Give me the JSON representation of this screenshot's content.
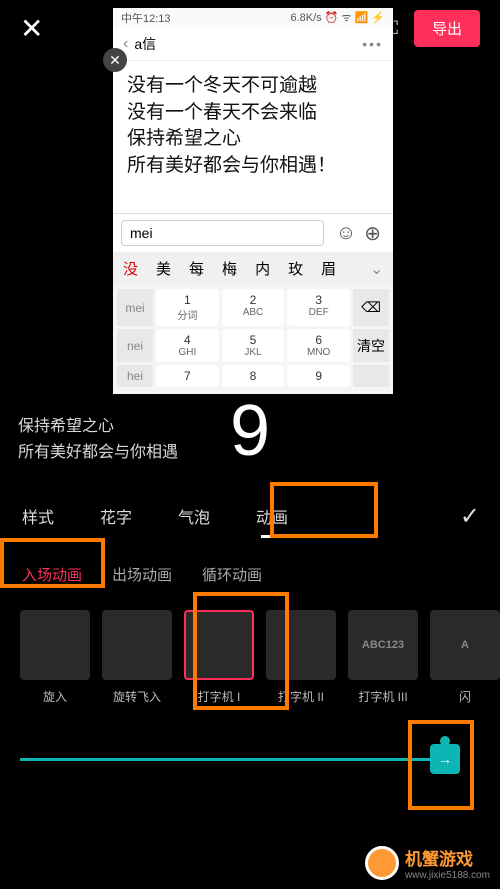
{
  "topbar": {
    "export_label": "导出"
  },
  "phone": {
    "status_time": "中午12:13",
    "status_right": "6.8K/s ⏰ ᯤ 📶 ⚡",
    "chat_title": "a信",
    "text_line1": "没有一个冬天不可逾越",
    "text_line2": "没有一个春天不会来临",
    "text_line3": "保持希望之心",
    "text_line4": "所有美好都会与你相遇！",
    "input_value": "mei",
    "suggestions": [
      "没",
      "美",
      "每",
      "梅",
      "内",
      "玫",
      "眉"
    ],
    "keyb_side": [
      "mei",
      "nei",
      "hei"
    ],
    "keyb_keys": [
      {
        "num": "1",
        "abc": "分词"
      },
      {
        "num": "2",
        "abc": "ABC"
      },
      {
        "num": "3",
        "abc": "DEF"
      },
      {
        "num": "4",
        "abc": "GHI"
      },
      {
        "num": "5",
        "abc": "JKL"
      },
      {
        "num": "6",
        "abc": "MNO"
      },
      {
        "num": "7",
        "abc": ""
      },
      {
        "num": "8",
        "abc": ""
      },
      {
        "num": "9",
        "abc": ""
      }
    ],
    "keyb_extra": [
      "⌫",
      "清空"
    ]
  },
  "big_number": "9",
  "preview_line1": "保持希望之心",
  "preview_line2": "所有美好都会与你相遇",
  "tabs": {
    "style": "样式",
    "flower": "花字",
    "bubble": "气泡",
    "animation": "动画"
  },
  "subtabs": {
    "enter": "入场动画",
    "exit": "出场动画",
    "loop": "循环动画"
  },
  "animations": [
    {
      "label": "旋入",
      "thumb": ""
    },
    {
      "label": "旋转飞入",
      "thumb": ""
    },
    {
      "label": "打字机 I",
      "thumb": ""
    },
    {
      "label": "打字机 II",
      "thumb": ""
    },
    {
      "label": "打字机 III",
      "thumb": "ABC123"
    },
    {
      "label": "闪",
      "thumb": "A"
    }
  ],
  "watermark": {
    "name": "机蟹游戏",
    "url": "www.jixie5188.com"
  }
}
